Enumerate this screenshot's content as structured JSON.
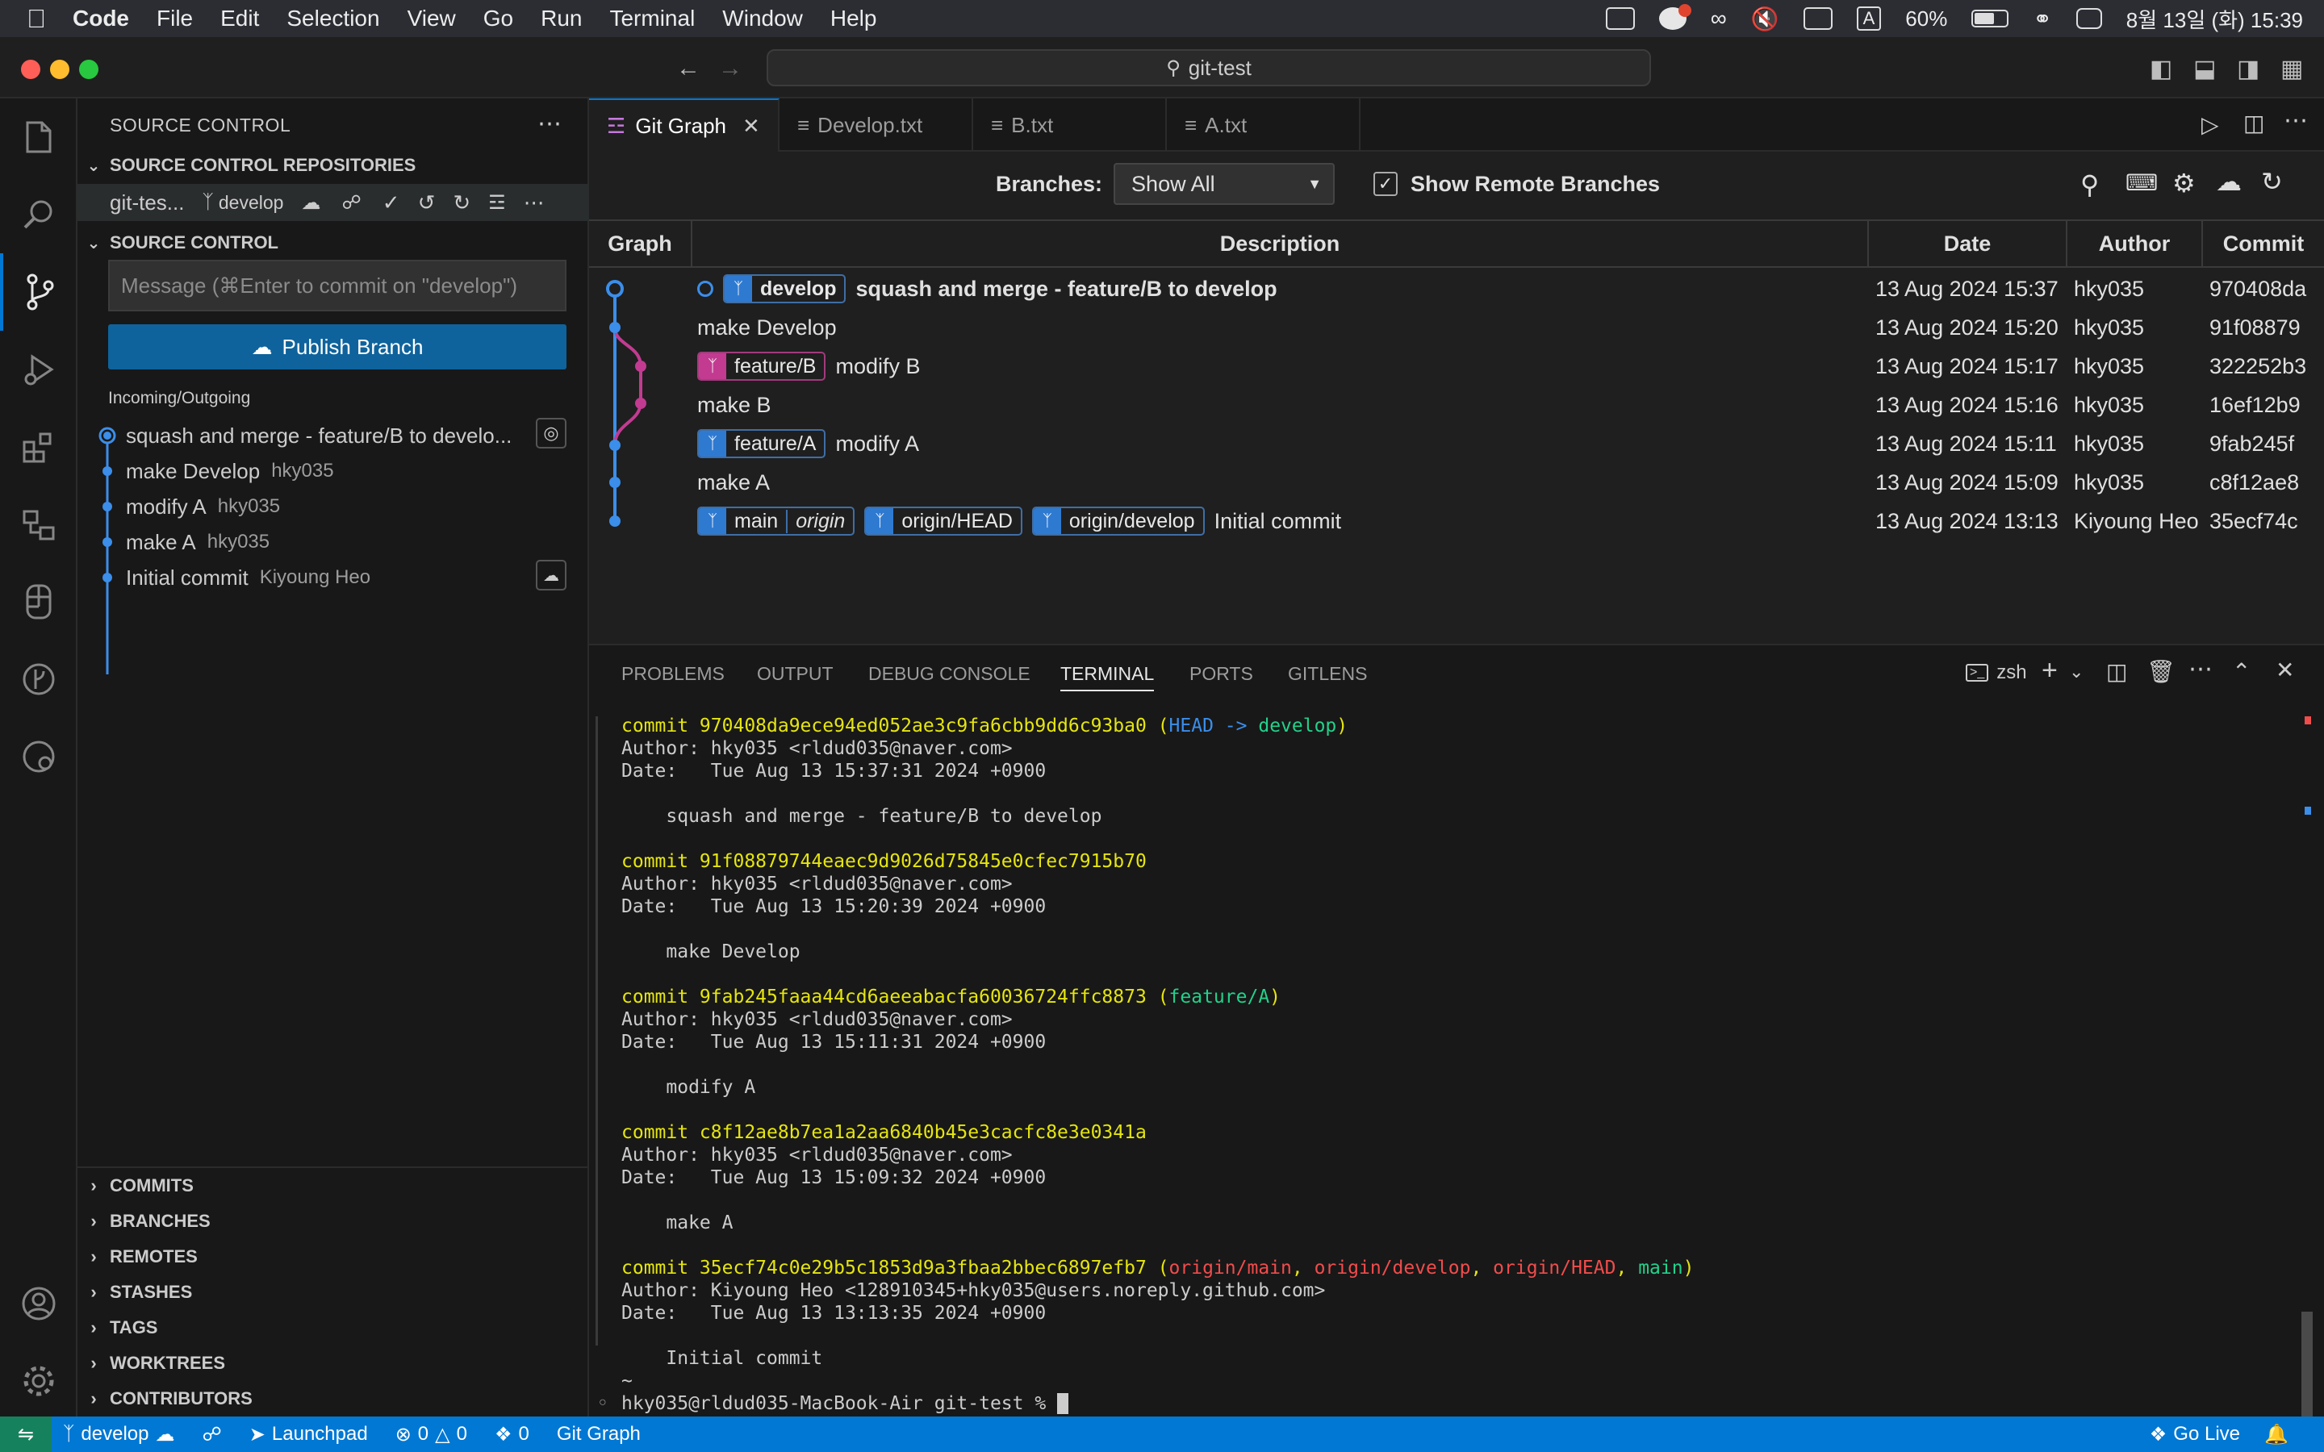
{
  "menubar": {
    "app": "Code",
    "items": [
      "File",
      "Edit",
      "Selection",
      "View",
      "Go",
      "Run",
      "Terminal",
      "Window",
      "Help"
    ],
    "battery": "60%",
    "input": "A",
    "datetime": "8월 13일 (화) 15:39"
  },
  "titlebar": {
    "search": "git-test"
  },
  "sidebar": {
    "title": "SOURCE CONTROL",
    "repos_header": "SOURCE CONTROL REPOSITORIES",
    "repo_name": "git-tes...",
    "repo_branch": "develop",
    "sc_header": "SOURCE CONTROL",
    "message_placeholder": "Message (⌘Enter to commit on \"develop\")",
    "publish": "Publish Branch",
    "incoming_label": "Incoming/Outgoing",
    "history": [
      {
        "msg": "squash and merge - feature/B to develo...",
        "author": ""
      },
      {
        "msg": "make Develop",
        "author": "hky035"
      },
      {
        "msg": "modify A",
        "author": "hky035"
      },
      {
        "msg": "make A",
        "author": "hky035"
      },
      {
        "msg": "Initial commit",
        "author": "Kiyoung Heo"
      }
    ],
    "bottom_sections": [
      "COMMITS",
      "BRANCHES",
      "REMOTES",
      "STASHES",
      "TAGS",
      "WORKTREES",
      "CONTRIBUTORS"
    ]
  },
  "tabs": [
    "Git Graph",
    "Develop.txt",
    "B.txt",
    "A.txt"
  ],
  "gitgraph": {
    "branches_label": "Branches:",
    "branches_value": "Show All",
    "show_remote": "Show Remote Branches",
    "columns": [
      "Graph",
      "Description",
      "Date",
      "Author",
      "Commit"
    ],
    "rows": [
      {
        "refs": [
          {
            "name": "develop",
            "color": "blue",
            "bold": true
          }
        ],
        "desc": "squash and merge - feature/B to develop",
        "date": "13 Aug 2024 15:37",
        "author": "hky035",
        "hash": "970408da"
      },
      {
        "refs": [],
        "desc": "make Develop",
        "date": "13 Aug 2024 15:20",
        "author": "hky035",
        "hash": "91f08879"
      },
      {
        "refs": [
          {
            "name": "feature/B",
            "color": "pink"
          }
        ],
        "desc": "modify B",
        "date": "13 Aug 2024 15:17",
        "author": "hky035",
        "hash": "322252b3"
      },
      {
        "refs": [],
        "desc": "make B",
        "date": "13 Aug 2024 15:16",
        "author": "hky035",
        "hash": "16ef12b9"
      },
      {
        "refs": [
          {
            "name": "feature/A",
            "color": "blue"
          }
        ],
        "desc": "modify A",
        "date": "13 Aug 2024 15:11",
        "author": "hky035",
        "hash": "9fab245f"
      },
      {
        "refs": [],
        "desc": "make A",
        "date": "13 Aug 2024 15:09",
        "author": "hky035",
        "hash": "c8f12ae8"
      },
      {
        "refs": [
          {
            "name": "main",
            "sub": "origin",
            "color": "blue"
          },
          {
            "name": "origin/HEAD",
            "color": "blue"
          },
          {
            "name": "origin/develop",
            "color": "blue"
          }
        ],
        "desc": "Initial commit",
        "date": "13 Aug 2024 13:13",
        "author": "Kiyoung Heo",
        "hash": "35ecf74c"
      }
    ]
  },
  "panel": {
    "tabs": [
      "PROBLEMS",
      "OUTPUT",
      "DEBUG CONSOLE",
      "TERMINAL",
      "PORTS",
      "GITLENS"
    ],
    "shell": "zsh",
    "terminal": {
      "c1": "commit 970408da9ece94ed052ae3c9fa6cbb9dd6c93ba0",
      "c1_head": "HEAD ->",
      "c1_branch": "develop",
      "c1_author": "Author: hky035 <rldud035@naver.com>",
      "c1_date": "Date:   Tue Aug 13 15:37:31 2024 +0900",
      "c1_msg": "    squash and merge - feature/B to develop",
      "c2": "commit 91f08879744eaec9d9026d75845e0cfec7915b70",
      "c2_author": "Author: hky035 <rldud035@naver.com>",
      "c2_date": "Date:   Tue Aug 13 15:20:39 2024 +0900",
      "c2_msg": "    make Develop",
      "c3": "commit 9fab245faaa44cd6aeeabacfa60036724ffc8873",
      "c3_branch": "feature/A",
      "c3_author": "Author: hky035 <rldud035@naver.com>",
      "c3_date": "Date:   Tue Aug 13 15:11:31 2024 +0900",
      "c3_msg": "    modify A",
      "c4": "commit c8f12ae8b7ea1a2aa6840b45e3cacfc8e3e0341a",
      "c4_author": "Author: hky035 <rldud035@naver.com>",
      "c4_date": "Date:   Tue Aug 13 15:09:32 2024 +0900",
      "c4_msg": "    make A",
      "c5": "commit 35ecf74c0e29b5c1853d9a3fbaa2bbec6897efb7",
      "c5_r1": "origin/main",
      "c5_r2": "origin/develop",
      "c5_r3": "origin/HEAD",
      "c5_r4": "main",
      "c5_author": "Author: Kiyoung Heo <128910345+hky035@users.noreply.github.com>",
      "c5_date": "Date:   Tue Aug 13 13:13:35 2024 +0900",
      "c5_msg": "    Initial commit",
      "tilde": "~",
      "prompt": "hky035@rldud035-MacBook-Air git-test % "
    }
  },
  "status": {
    "branch": "develop",
    "launchpad": "Launchpad",
    "errors": "0",
    "warnings": "0",
    "ports": "0",
    "gitgraph": "Git Graph",
    "golive": "Go Live"
  }
}
